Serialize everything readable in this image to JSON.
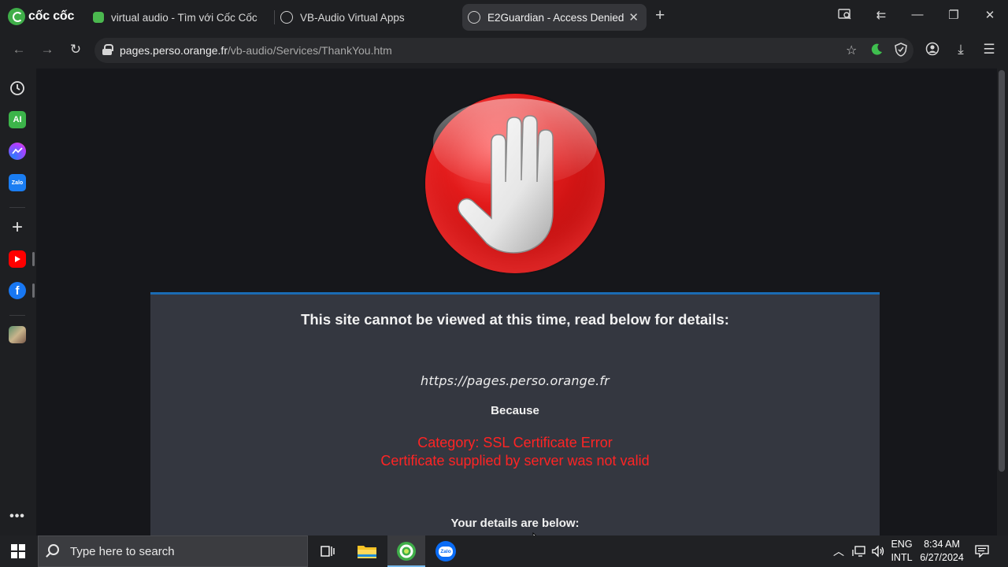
{
  "browser": {
    "brand": "cốc cốc",
    "tabs": [
      {
        "label": "virtual audio - Tìm với Cốc Cốc",
        "active": false
      },
      {
        "label": "VB-Audio Virtual Apps",
        "active": false
      },
      {
        "label": "E2Guardian - Access Denied",
        "active": true
      }
    ],
    "address": {
      "host": "pages.perso.orange.fr",
      "path": "/vb-audio/Services/ThankYou.htm"
    }
  },
  "sidebar": {
    "items": [
      "history-icon",
      "ai-icon",
      "messenger-icon",
      "zalo-icon",
      "add-icon",
      "youtube-icon",
      "facebook-icon",
      "photo-icon",
      "more-icon"
    ],
    "ai_label": "AI",
    "zalo_label": "Zalo"
  },
  "page": {
    "title": "This site cannot be viewed at this time, read below for details:",
    "blocked_url": "https://pages.perso.orange.fr",
    "because": "Because",
    "reason_line1": "Category: SSL Certificate Error",
    "reason_line2": "Certificate supplied by server was not valid",
    "details": "Your details are below:"
  },
  "colors": {
    "accent": "#1a6bb3",
    "error_red": "#ff2424",
    "panel_bg": "#343740",
    "page_bg": "#16171b"
  },
  "taskbar": {
    "search_placeholder": "Type here to search",
    "language_top": "ENG",
    "language_bottom": "INTL",
    "time": "8:34 AM",
    "date": "6/27/2024",
    "zalo_label": "Zalo"
  }
}
